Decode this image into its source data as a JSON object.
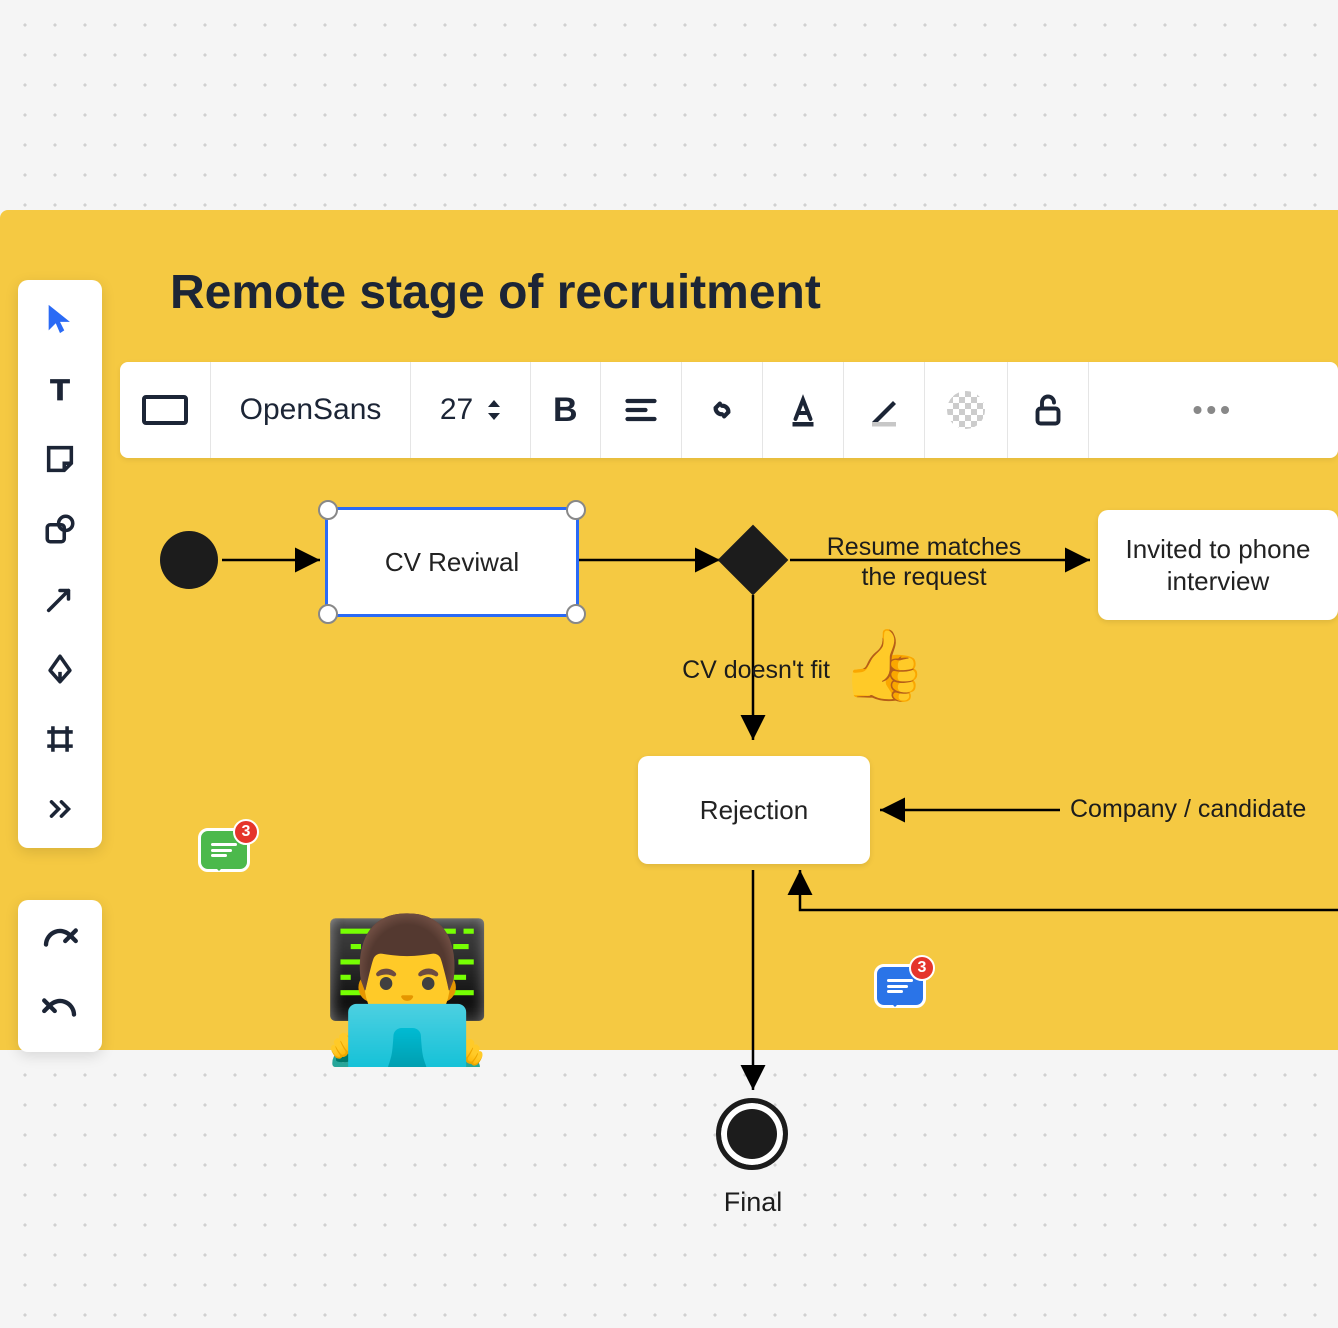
{
  "title": "Remote stage of recruitment",
  "format_toolbar": {
    "shape_tool": "rectangle",
    "font_family": "OpenSans",
    "font_size": "27",
    "bold_label": "B"
  },
  "toolbox": {
    "select": "select-tool",
    "text": "text-tool",
    "sticky": "sticky-note-tool",
    "shape": "shape-tool",
    "arrow": "arrow-tool",
    "pen": "pen-tool",
    "frame": "frame-tool",
    "more": "more-tools"
  },
  "nodes": {
    "cv_revival": "CV Reviwal",
    "invited": "Invited to phone interview",
    "rejection": "Rejection",
    "final_label": "Final"
  },
  "edges": {
    "resume_matches": "Resume matches the request",
    "cv_doesnt_fit": "CV doesn't fit",
    "company_candidate": "Company / candidate"
  },
  "comments": {
    "green_count": "3",
    "blue_count": "3"
  }
}
